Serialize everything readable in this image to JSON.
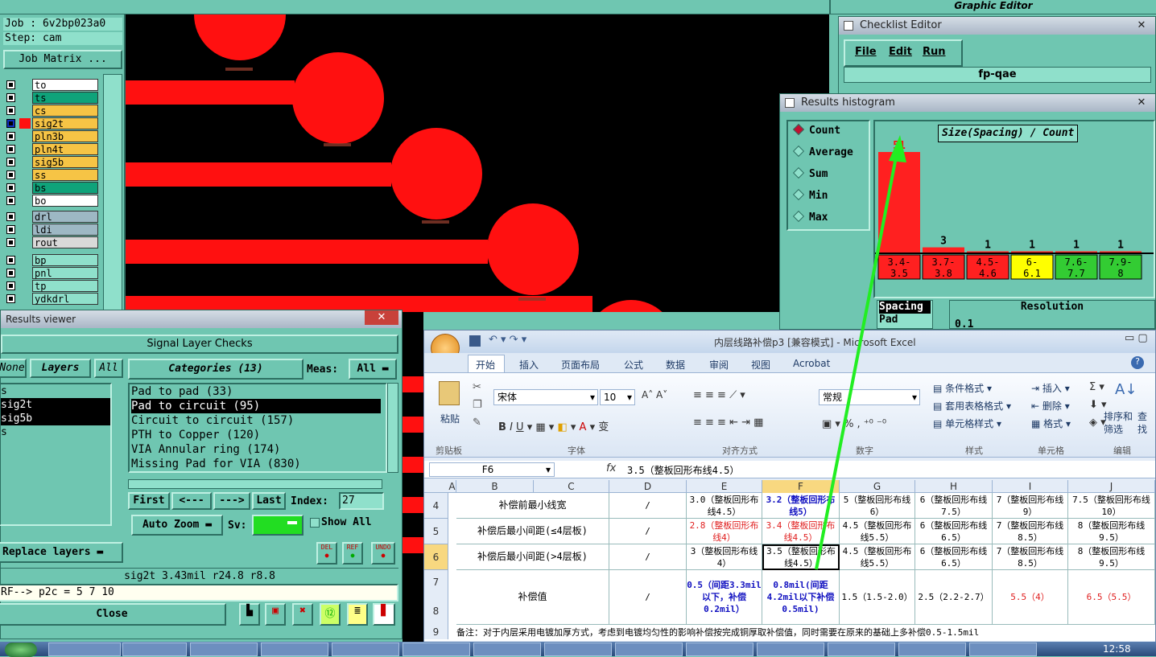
{
  "app": {
    "title_right": "Graphic Editor"
  },
  "job": {
    "job_line": "Job : 6v2bp023a0",
    "step_line": "Step: cam",
    "matrix_button": "Job Matrix ..."
  },
  "layers": [
    {
      "name": "to",
      "color": "#ffffff"
    },
    {
      "name": "ts",
      "color": "#0fa37a"
    },
    {
      "name": "cs",
      "color": "#f6c445"
    },
    {
      "name": "sig2t",
      "color": "#f6c445"
    },
    {
      "name": "pln3b",
      "color": "#f6c445"
    },
    {
      "name": "pln4t",
      "color": "#f6c445"
    },
    {
      "name": "sig5b",
      "color": "#f6c445"
    },
    {
      "name": "ss",
      "color": "#f6c445"
    },
    {
      "name": "bs",
      "color": "#0fa37a"
    },
    {
      "name": "bo",
      "color": "#ffffff"
    },
    {
      "name": "drl",
      "color": "#9db8c4"
    },
    {
      "name": "ldi",
      "color": "#9db8c4"
    },
    {
      "name": "rout",
      "color": "#d9d9d9"
    },
    {
      "name": "bp",
      "color": "#8fe0cb"
    },
    {
      "name": "pnl",
      "color": "#8fe0cb"
    },
    {
      "name": "tp",
      "color": "#8fe0cb"
    },
    {
      "name": "ydkdrl",
      "color": "#8fe0cb"
    }
  ],
  "checklist": {
    "title": "Checklist Editor",
    "menu": [
      "File",
      "Edit",
      "Run"
    ],
    "name": "fp-qae"
  },
  "histogram": {
    "title": "Results histogram",
    "modes": [
      "Count",
      "Average",
      "Sum",
      "Min",
      "Max"
    ],
    "selected_mode": "Count",
    "chart_title": "Size(Spacing) / Count",
    "left_label_1": "Spacing",
    "left_label_2": "Pad",
    "resolution_label": "Resolution",
    "resolution_value": "0.1"
  },
  "chart_data": {
    "type": "bar",
    "title": "Size(Spacing) / Count",
    "categories": [
      "3.4-\n3.5",
      "3.7-\n3.8",
      "4.5-\n4.6",
      "6-\n6.1",
      "7.6-\n7.7",
      "7.9-\n8"
    ],
    "values": [
      51,
      3,
      1,
      1,
      1,
      1
    ],
    "category_colors": [
      "#ff2020",
      "#ff2020",
      "#ff2020",
      "#ffff00",
      "#33cc33",
      "#33cc33"
    ],
    "bar_color": "#ff2020",
    "ylim": [
      0,
      51
    ]
  },
  "results": {
    "title": "Results viewer",
    "header": "Signal Layer Checks",
    "filters": [
      "None",
      "Layers",
      "All"
    ],
    "layers": [
      "s",
      "sig2t",
      "sig5b",
      "s"
    ],
    "categories_label": "Categories (13)",
    "meas_label": "Meas:",
    "meas_value": "All",
    "categories": [
      "Pad to pad (33)",
      "Pad to circuit (95)",
      "Circuit to circuit (157)",
      "PTH to Copper (120)",
      "VIA Annular ring (174)",
      "Missing Pad for VIA (830)"
    ],
    "selected_category": 1,
    "nav": [
      "First",
      "<---",
      "--->",
      "Last"
    ],
    "index_label": "Index:",
    "index_value": "27",
    "auto_zoom": "Auto Zoom",
    "sv_label": "Sv:",
    "show_all": "Show All",
    "replace_layers": "Replace layers",
    "tool_labels": [
      "DEL",
      "REF",
      "UNDO"
    ],
    "status": "sig2t 3.43mil  r24.8  r8.8",
    "ref_line": "RF--> p2c = 5 7 10",
    "close": "Close"
  },
  "excel": {
    "title": "内层线路补偿p3 [兼容模式] - Microsoft Excel",
    "tabs": [
      "开始",
      "插入",
      "页面布局",
      "公式",
      "数据",
      "审阅",
      "视图",
      "Acrobat"
    ],
    "groups": [
      "剪贴板",
      "字体",
      "对齐方式",
      "数字",
      "样式",
      "单元格",
      "编辑"
    ],
    "font_name": "宋体",
    "font_size": "10",
    "number_format": "常规",
    "paste": "粘贴",
    "styles": [
      "条件格式",
      "套用表格格式",
      "单元格样式"
    ],
    "cells_cmds": [
      "插入",
      "删除",
      "格式"
    ],
    "edit_cmds": [
      "排序和筛选",
      "查找和选择"
    ],
    "name_box": "F6",
    "formula": "3.5（整板回形布线4.5）",
    "columns": [
      "A",
      "B",
      "C",
      "D",
      "E",
      "F",
      "G",
      "H",
      "I",
      "J"
    ],
    "rows": [
      {
        "num": "4",
        "label": "补偿前最小线宽",
        "d": "/",
        "cells": [
          "3.0（整板回形布线4.5）",
          "3.2（整板回形布线5）",
          "5（整板回形布线6）",
          "6（整板回形布线7.5）",
          "7（整板回形布线9）",
          "7.5（整板回形布线10）"
        ]
      },
      {
        "num": "5",
        "label": "补偿后最小间距(≤4层板)",
        "d": "/",
        "cells": [
          "2.8（整板回形布线4）",
          "3.4（整板回形布线4.5）",
          "4.5（整板回形布线5.5）",
          "6（整板回形布线6.5）",
          "7（整板回形布线8.5）",
          "8（整板回形布线9.5）"
        ]
      },
      {
        "num": "6",
        "label": "补偿后最小间距(>4层板)",
        "d": "/",
        "cells": [
          "3（整板回形布线4）",
          "3.5（整板回形布线4.5）",
          "4.5（整板回形布线5.5）",
          "6（整板回形布线6.5）",
          "7（整板回形布线8.5）",
          "8（整板回形布线9.5）"
        ]
      },
      {
        "num": "7",
        "label": "补偿值",
        "d": "/",
        "cells": [
          "0.5（间距3.3mil以下，补偿0.2mil）",
          "0.8mil(间距4.2mil以下补偿0.5mil)",
          "1.5（1.5-2.0）",
          "2.5（2.2-2.7）",
          "5.5（4）",
          "6.5（5.5）"
        ]
      }
    ],
    "row8_num": "8",
    "row9_num": "9",
    "note": "备注：对于内层采用电镀加厚方式，考虑到电镀均匀性的影响补偿按完成铜厚取补偿值，同时需要在原来的基础上多补偿0.5-1.5mil"
  },
  "taskbar": {
    "clock": "12:58"
  }
}
